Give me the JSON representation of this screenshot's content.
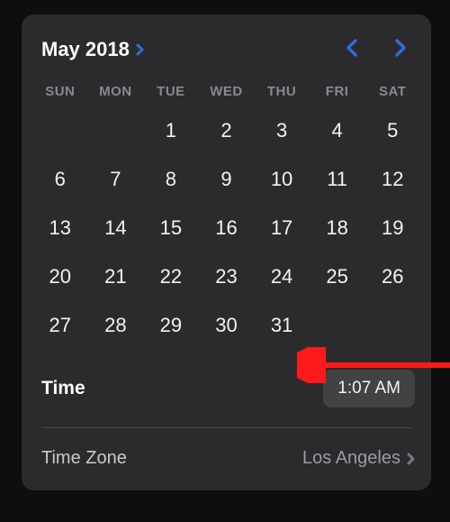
{
  "header": {
    "month_year": "May 2018"
  },
  "days_of_week": [
    "SUN",
    "MON",
    "TUE",
    "WED",
    "THU",
    "FRI",
    "SAT"
  ],
  "calendar": {
    "leading_blanks": 2,
    "days": [
      "1",
      "2",
      "3",
      "4",
      "5",
      "6",
      "7",
      "8",
      "9",
      "10",
      "11",
      "12",
      "13",
      "14",
      "15",
      "16",
      "17",
      "18",
      "19",
      "20",
      "21",
      "22",
      "23",
      "24",
      "25",
      "26",
      "27",
      "28",
      "29",
      "30",
      "31"
    ]
  },
  "time": {
    "label": "Time",
    "value": "1:07 AM"
  },
  "timezone": {
    "label": "Time Zone",
    "value": "Los Angeles"
  }
}
